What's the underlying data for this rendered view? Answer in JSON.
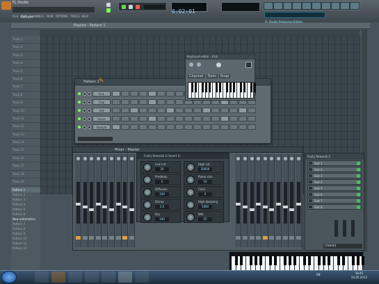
{
  "window": {
    "title": "FL Studio"
  },
  "menu": {
    "items": [
      "FILE",
      "EDIT",
      "CHANNELS",
      "VIEW",
      "OPTIONS",
      "TOOLS",
      "HELP"
    ]
  },
  "mode_label": "Pattern",
  "transport": {
    "time": "0:02:01"
  },
  "hint_bar": {
    "text": "FL Studio Producing Edition"
  },
  "playlist": {
    "title": "Playlist - Pattern 1",
    "tracks": [
      "Track 1",
      "Track 2",
      "Track 3",
      "Track 4",
      "Track 5",
      "Track 6",
      "Track 7",
      "Track 8",
      "Track 9",
      "Track 10",
      "Track 11",
      "Track 12",
      "Track 13",
      "Track 14",
      "Track 15",
      "Track 16",
      "Track 17",
      "Track 18",
      "Track 19",
      "Track 20"
    ]
  },
  "automation": {
    "pattern_label": "Pattern 1",
    "items": [
      "Pattern 2",
      "Pattern 3",
      "Pattern 4",
      "Pattern 5",
      "Pattern 6"
    ],
    "new_label": "New automation",
    "more": [
      "Pattern 7",
      "Pattern 8",
      "Pattern 9",
      "Pattern 10",
      "Pattern 11",
      "Pattern 12"
    ]
  },
  "step_sequencer": {
    "title": "Pattern 1",
    "channels": [
      "Kick",
      "Clap",
      "Hat",
      "Snare",
      "Sample"
    ],
    "active_steps": [
      [
        0,
        4,
        8,
        12
      ],
      [
        4,
        12
      ],
      [
        2,
        6,
        10,
        14
      ],
      [
        4,
        12
      ],
      [
        0
      ]
    ]
  },
  "piano_roll": {
    "title": "Keyboard editor - Kick",
    "buttons": [
      "Channel",
      "Tools",
      "Snap"
    ]
  },
  "mixer": {
    "title": "Mixer - Master",
    "channel_count": 34
  },
  "plugin": {
    "title": "Fruity Reeverb 2 (Insert 1)",
    "params": [
      {
        "label": "Low cut",
        "value": "20"
      },
      {
        "label": "High cut",
        "value": "20000"
      },
      {
        "label": "Predelay",
        "value": "0"
      },
      {
        "label": "Room size",
        "value": "50"
      },
      {
        "label": "Diffusion",
        "value": "100"
      },
      {
        "label": "Color",
        "value": "0"
      },
      {
        "label": "Decay",
        "value": "2.0"
      },
      {
        "label": "High damping",
        "value": "5000"
      },
      {
        "label": "Dry",
        "value": "100"
      },
      {
        "label": "Wet",
        "value": "25"
      }
    ]
  },
  "send_panel": {
    "title": "Fruity Reeverb 2",
    "slots": [
      "Slot 1",
      "Slot 2",
      "Slot 3",
      "Slot 4",
      "Slot 5",
      "Slot 6",
      "Slot 7",
      "Slot 8"
    ],
    "bottom": "(none)"
  },
  "taskbar": {
    "lang": "EN",
    "time": "18:45",
    "date": "24.05.2013"
  }
}
